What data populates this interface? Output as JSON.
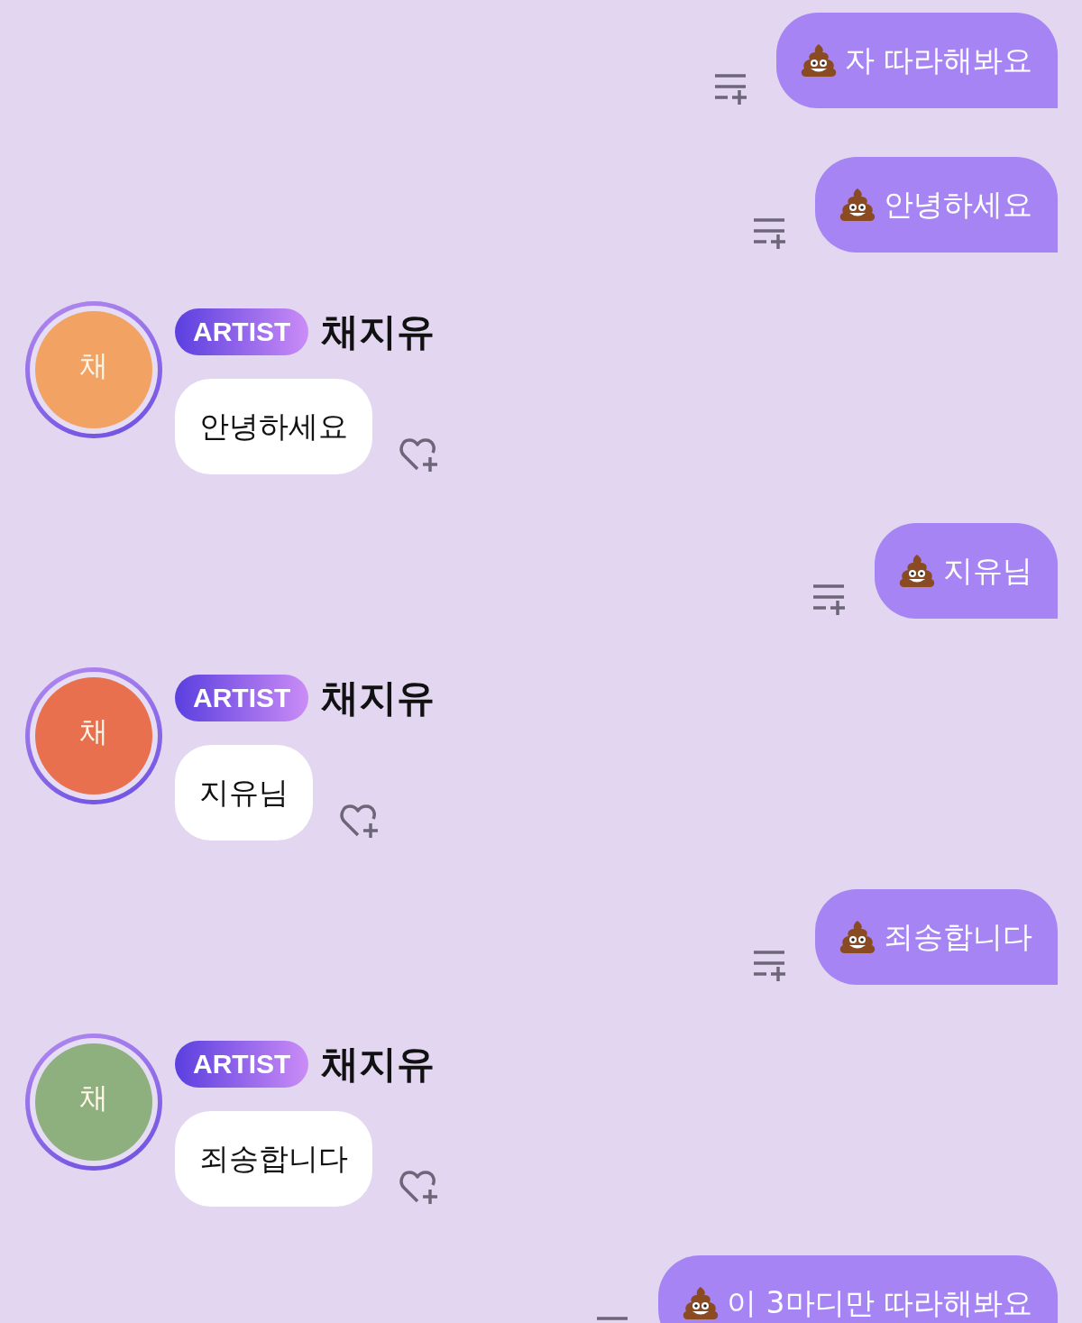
{
  "messages": [
    {
      "kind": "sent",
      "text": "자 따라해봐요"
    },
    {
      "kind": "sent",
      "text": "안녕하세요"
    },
    {
      "kind": "received",
      "avatar": {
        "initial": "채",
        "color": "#f2a263"
      },
      "badge": "ARTIST",
      "name": "채지유",
      "text": "안녕하세요"
    },
    {
      "kind": "sent",
      "text": "지유님"
    },
    {
      "kind": "received",
      "avatar": {
        "initial": "채",
        "color": "#e8704f"
      },
      "badge": "ARTIST",
      "name": "채지유",
      "text": "지유님"
    },
    {
      "kind": "sent",
      "text": "죄송합니다"
    },
    {
      "kind": "received",
      "avatar": {
        "initial": "채",
        "color": "#8db07e"
      },
      "badge": "ARTIST",
      "name": "채지유",
      "text": "죄송합니다"
    },
    {
      "kind": "sent",
      "text": "이 3마디만 따라해봐요"
    }
  ]
}
